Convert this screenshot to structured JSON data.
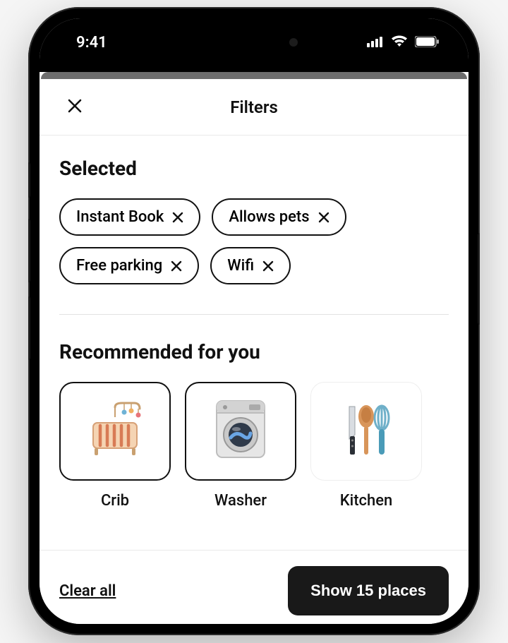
{
  "statusbar": {
    "time": "9:41"
  },
  "header": {
    "title": "Filters"
  },
  "selected": {
    "title": "Selected",
    "chips": [
      {
        "label": "Instant Book"
      },
      {
        "label": "Allows pets"
      },
      {
        "label": "Free parking"
      },
      {
        "label": "Wifi"
      }
    ]
  },
  "recommended": {
    "title": "Recommended for you",
    "cards": [
      {
        "label": "Crib"
      },
      {
        "label": "Washer"
      },
      {
        "label": "Kitchen"
      }
    ]
  },
  "footer": {
    "clear_label": "Clear all",
    "show_label": "Show 15 places"
  }
}
